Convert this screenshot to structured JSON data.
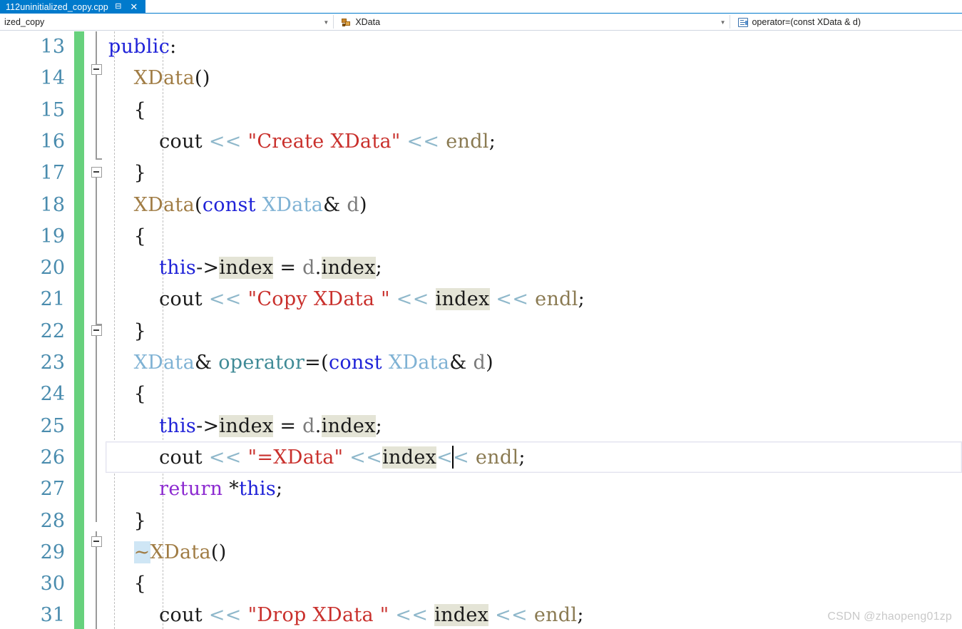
{
  "window": {
    "accent_color": "#007acc",
    "change_bar_color": "#67d17d"
  },
  "tab_bar": {
    "active_tab": {
      "label": "112uninitialized_copy.cpp",
      "pin_icon": "pin-icon",
      "close_icon": "close-icon"
    }
  },
  "navigation_bar": {
    "project": {
      "text": "ized_copy",
      "dropdown_icon": "chevron-down-icon"
    },
    "type": {
      "icon": "class-icon",
      "text": "XData",
      "dropdown_icon": "chevron-down-icon"
    },
    "member": {
      "icon": "member-icon",
      "text": "operator=(const XData & d)"
    }
  },
  "editor": {
    "current_line_number": 26,
    "caret_after_token": "index",
    "watermark": "CSDN @zhaopeng01zp",
    "line_numbers": [
      13,
      14,
      15,
      16,
      17,
      18,
      19,
      20,
      21,
      22,
      23,
      24,
      25,
      26,
      27,
      28,
      29,
      30,
      31
    ],
    "lines": [
      {
        "n": 13,
        "text": "public:"
      },
      {
        "n": 14,
        "text": "    XData()"
      },
      {
        "n": 15,
        "text": "    {"
      },
      {
        "n": 16,
        "text": "        cout << \"Create XData\" << endl;"
      },
      {
        "n": 17,
        "text": "    }"
      },
      {
        "n": 18,
        "text": "    XData(const XData& d)"
      },
      {
        "n": 19,
        "text": "    {"
      },
      {
        "n": 20,
        "text": "        this->index = d.index;"
      },
      {
        "n": 21,
        "text": "        cout << \"Copy XData \" << index << endl;"
      },
      {
        "n": 22,
        "text": "    }"
      },
      {
        "n": 23,
        "text": "    XData& operator=(const XData& d)"
      },
      {
        "n": 24,
        "text": "    {"
      },
      {
        "n": 25,
        "text": "        this->index = d.index;"
      },
      {
        "n": 26,
        "text": "        cout << \"=XData\" <<index<< endl;"
      },
      {
        "n": 27,
        "text": "        return *this;"
      },
      {
        "n": 28,
        "text": "    }"
      },
      {
        "n": 29,
        "text": "    ~XData()"
      },
      {
        "n": 30,
        "text": "    {"
      },
      {
        "n": 31,
        "text": "        cout << \"Drop XData \" << index << endl;"
      }
    ],
    "outlining": {
      "collapse_markers": [
        14,
        18,
        23,
        29
      ]
    }
  }
}
